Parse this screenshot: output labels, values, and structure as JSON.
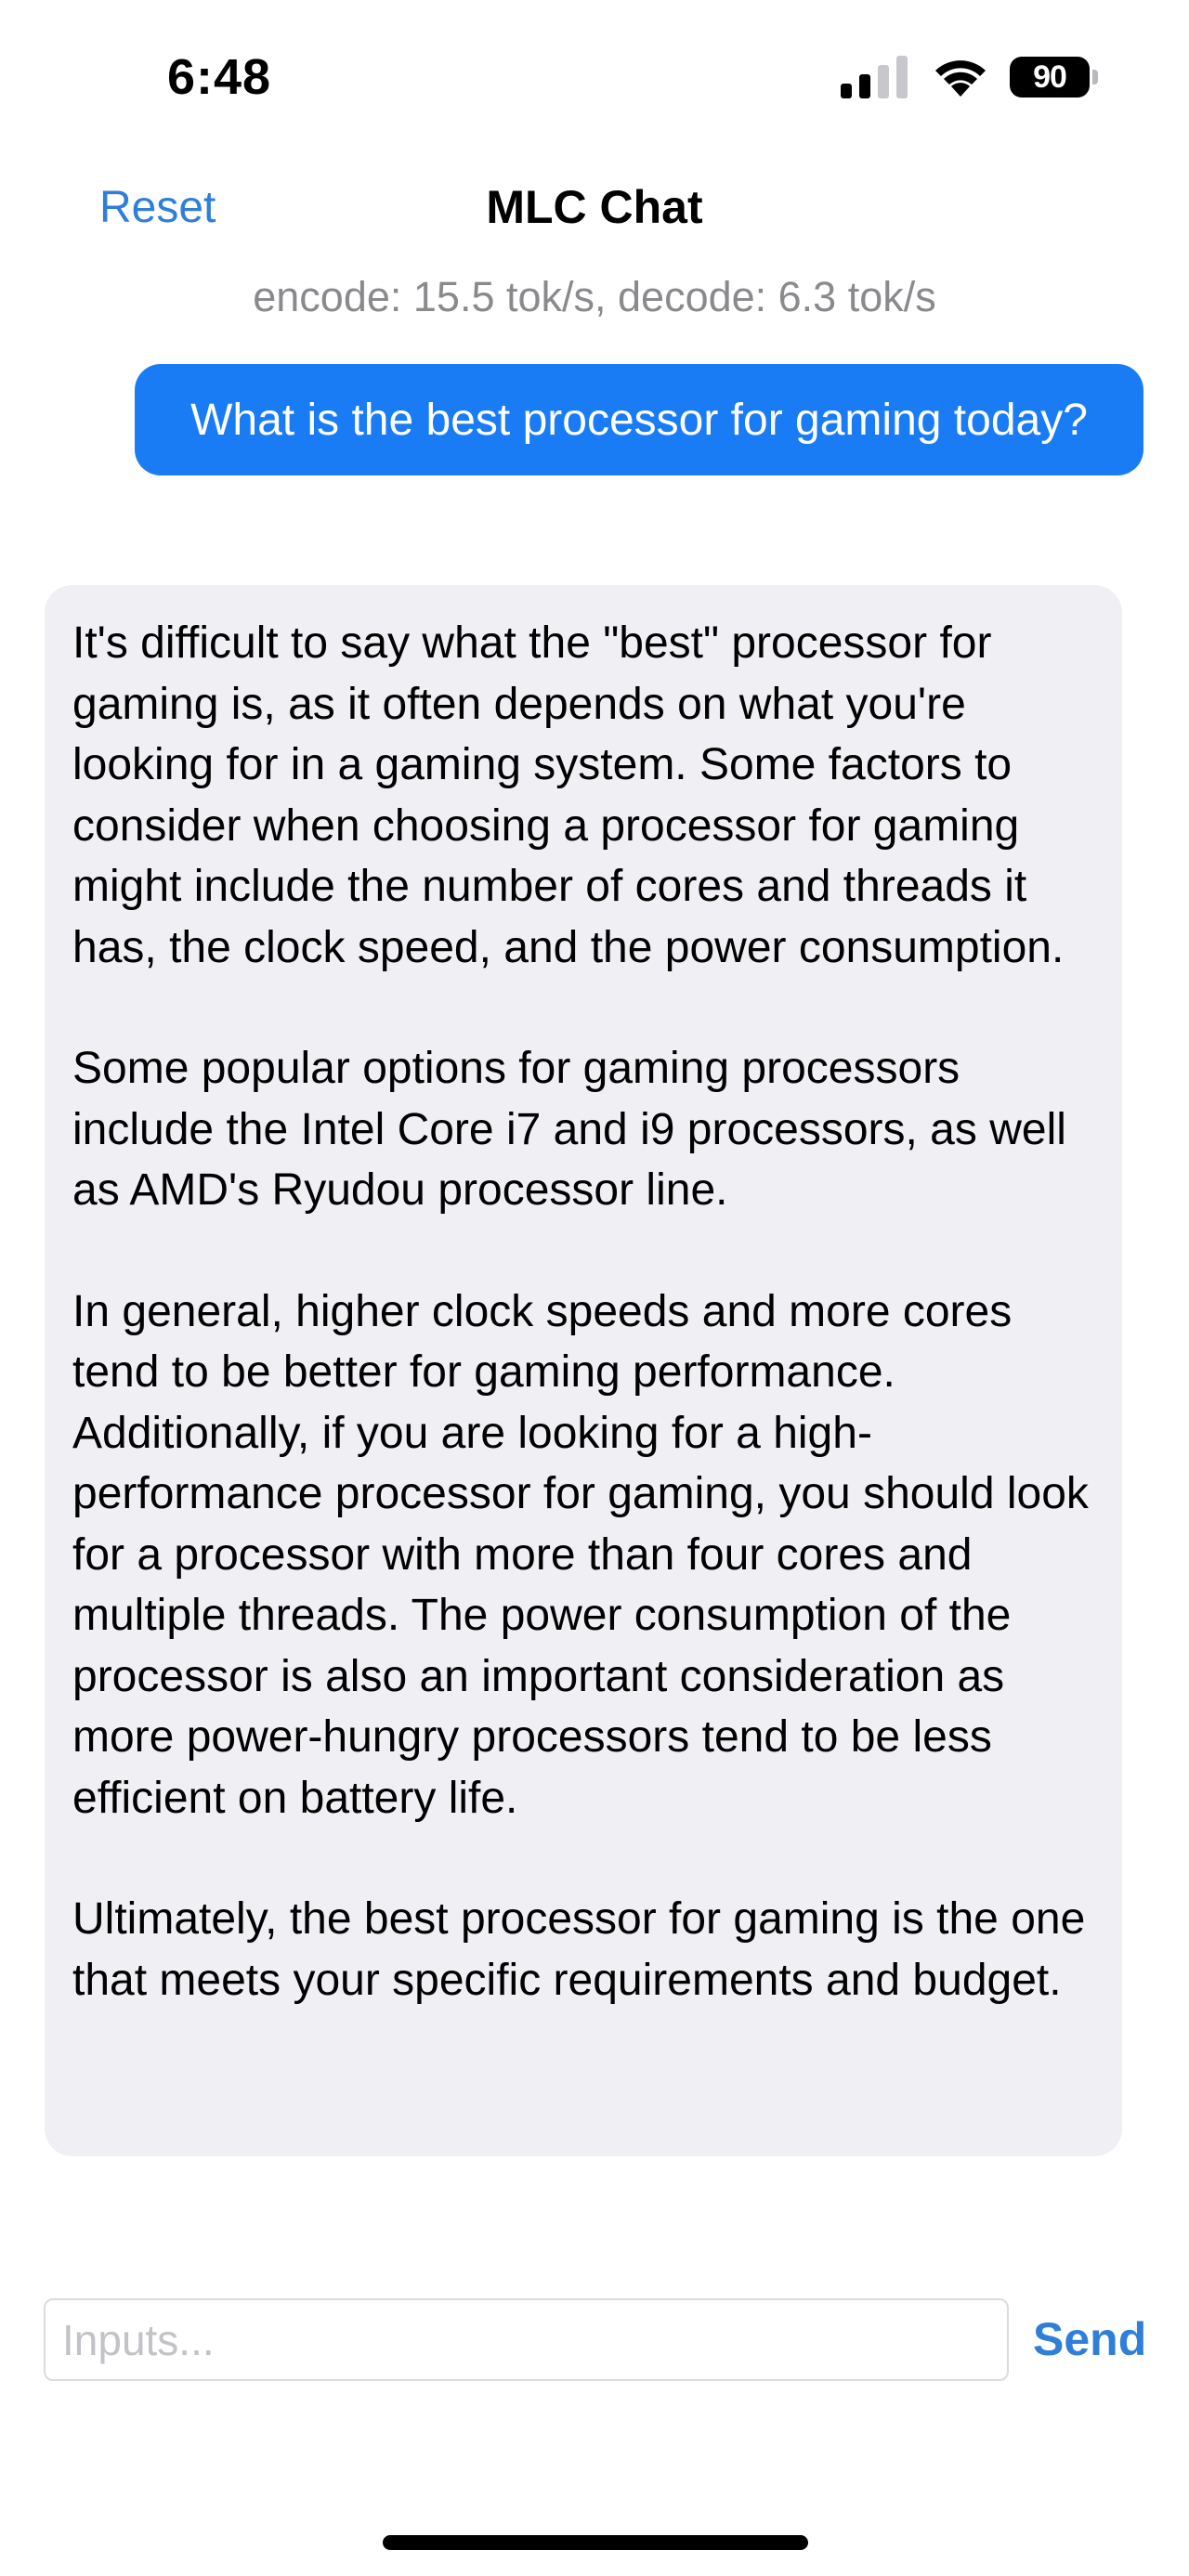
{
  "status_bar": {
    "time": "6:48",
    "battery": "90",
    "icons": [
      "cellular-signal-icon",
      "wifi-icon",
      "battery-icon"
    ]
  },
  "nav": {
    "reset_label": "Reset",
    "title": "MLC Chat"
  },
  "speed_text": "encode: 15.5 tok/s, decode: 6.3 tok/s",
  "messages": [
    {
      "role": "user",
      "text": "What is the best processor for gaming today?"
    },
    {
      "role": "assistant",
      "paragraphs": [
        "It's difficult to say what the \"best\" processor for gaming is, as it often depends on what you're looking for in a gaming system. Some factors to consider when choosing a processor for gaming might include the number of cores and threads it has, the clock speed, and the power consumption.",
        "Some popular options for gaming processors include the Intel Core i7 and i9 processors, as well as AMD's Ryudou processor line.",
        "In general, higher clock speeds and more cores tend to be better for gaming performance. Additionally, if you are looking for a high-performance processor for gaming, you should look for a processor with more than four cores and multiple threads. The power consumption of the processor is also an important consideration as more power-hungry processors tend to be less efficient on battery life.",
        "Ultimately, the best processor for gaming is the one that meets your specific requirements and budget."
      ]
    }
  ],
  "composer": {
    "placeholder": "Inputs...",
    "value": "",
    "send_label": "Send"
  },
  "colors": {
    "accent": "#2f7fd8",
    "user_bubble": "#1a7cf5",
    "assistant_bubble": "#efeff4",
    "secondary_text": "#8a8a8e"
  }
}
